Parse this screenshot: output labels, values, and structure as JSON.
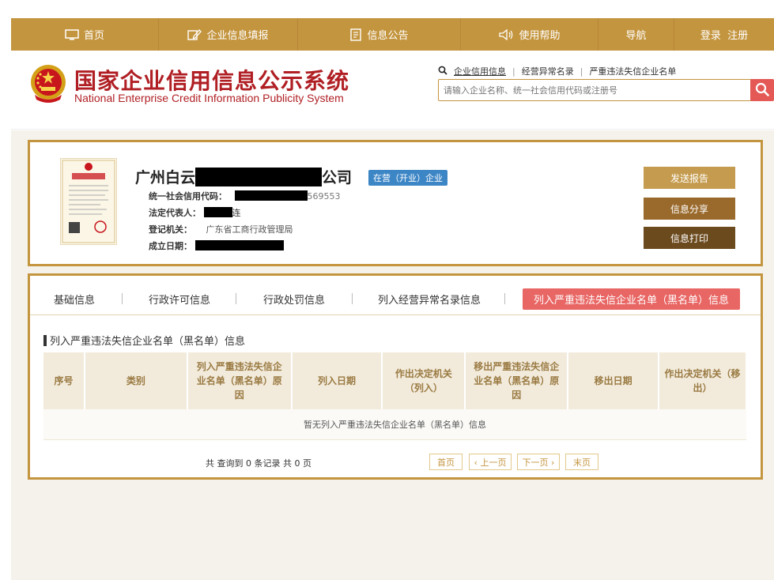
{
  "nav": {
    "items": [
      {
        "label": "首页",
        "icon": "monitor-icon"
      },
      {
        "label": "企业信息填报",
        "icon": "edit-icon"
      },
      {
        "label": "信息公告",
        "icon": "document-icon"
      },
      {
        "label": "使用帮助",
        "icon": "speaker-icon"
      },
      {
        "label": "导航",
        "icon": ""
      },
      {
        "label": "登录  注册",
        "icon": ""
      }
    ]
  },
  "header": {
    "title_cn": "国家企业信用信息公示系统",
    "title_en": "National Enterprise Credit Information Publicity System",
    "search_links": [
      "企业信用信息",
      "经营异常名录",
      "严重违法失信企业名单"
    ],
    "search_placeholder": "请输入企业名称、统一社会信用代码或注册号"
  },
  "company": {
    "name_prefix": "广州白云",
    "name_suffix": "公司",
    "status": "在营（开业）企业",
    "credit_code_label": "统一社会信用代码：",
    "credit_code_tail": "569553",
    "legal_rep_label": "法定代表人：",
    "legal_rep_tail": "连",
    "authority_label": "登记机关：",
    "authority_value": "广东省工商行政管理局",
    "established_label": "成立日期："
  },
  "actions": {
    "send_report": "发送报告",
    "share": "信息分享",
    "print": "信息打印"
  },
  "tabs": [
    "基础信息",
    "行政许可信息",
    "行政处罚信息",
    "列入经营异常名录信息",
    "列入严重违法失信企业名单（黑名单）信息"
  ],
  "section": {
    "title": "列入严重违法失信企业名单（黑名单）信息",
    "columns": [
      "序号",
      "类别",
      "列入严重违法失信企业名单（黑名单）原因",
      "列入日期",
      "作出决定机关（列入）",
      "移出严重违法失信企业名单（黑名单）原因",
      "移出日期",
      "作出决定机关（移出）"
    ],
    "empty_text": "暂无列入严重违法失信企业名单（黑名单）信息",
    "record_count": "共 查询到 0 条记录 共 0 页"
  },
  "pager": {
    "first": "首页",
    "prev": "‹ 上一页",
    "next": "下一页 ›",
    "last": "末页"
  },
  "colors": {
    "nav_gold": "#c4953f",
    "title_red": "#b01f24",
    "status_blue": "#3d86c6",
    "active_tab": "#e86664",
    "btn_report": "#c59c4f",
    "btn_share": "#9a6a2c",
    "btn_print": "#6b4a1d"
  }
}
